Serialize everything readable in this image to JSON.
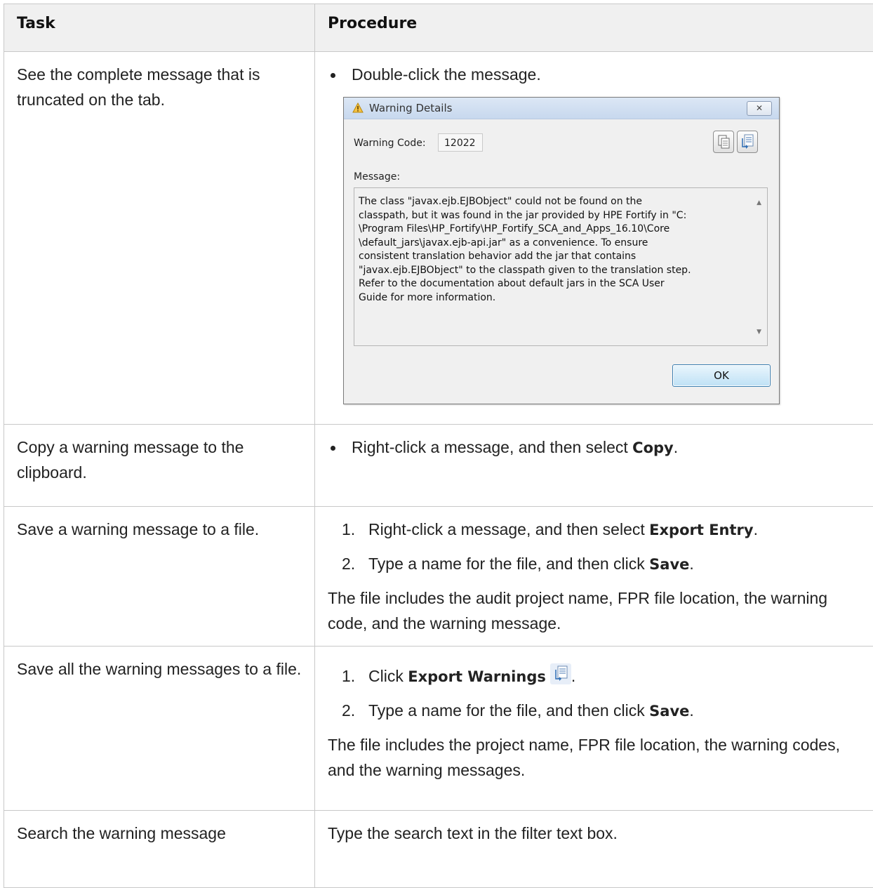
{
  "table": {
    "headers": [
      "Task",
      "Procedure"
    ],
    "rows": [
      {
        "task": "See the complete message that is truncated on the tab.",
        "bullet": "Double-click the message."
      },
      {
        "task": "Copy a warning message to the clipboard.",
        "bullet_prefix": "Right-click a message, and then select ",
        "bullet_bold": "Copy",
        "bullet_suffix": "."
      },
      {
        "task": "Save a warning message to a file.",
        "steps": [
          {
            "num": "1.",
            "prefix": "Right-click a message, and then select ",
            "bold": "Export Entry",
            "suffix": "."
          },
          {
            "num": "2.",
            "prefix": "Type a name for the file, and then click ",
            "bold": "Save",
            "suffix": "."
          }
        ],
        "note": "The file includes the audit project name, FPR file location, the warning code, and the warning message."
      },
      {
        "task": "Save all the warning messages to a file.",
        "steps": [
          {
            "num": "1.",
            "prefix": "Click ",
            "bold": "Export Warnings",
            "suffix": "."
          },
          {
            "num": "2.",
            "prefix": "Type a name for the file, and then click ",
            "bold": "Save",
            "suffix": "."
          }
        ],
        "note": "The file includes the project name, FPR file location, the warning codes, and the warning messages."
      },
      {
        "task": "Search the warning message",
        "text": "Type the search text in the filter text box."
      }
    ]
  },
  "dialog": {
    "title": "Warning Details",
    "close_label": "✕",
    "warning_code_label": "Warning Code:",
    "warning_code_value": "12022",
    "message_label": "Message:",
    "message_text": "The class \"javax.ejb.EJBObject\" could not be found on the\nclasspath, but it was found in the jar provided by HPE Fortify in \"C:\n\\Program Files\\HP_Fortify\\HP_Fortify_SCA_and_Apps_16.10\\Core\n\\default_jars\\javax.ejb-api.jar\" as a convenience. To ensure\nconsistent translation behavior add the jar that contains\n\"javax.ejb.EJBObject\" to the classpath given to the translation step.\nRefer to the documentation about default jars in the SCA User\nGuide for more information.",
    "ok_label": "OK",
    "icons": [
      "warning-icon",
      "close-icon",
      "copy-icon",
      "export-icon"
    ]
  }
}
